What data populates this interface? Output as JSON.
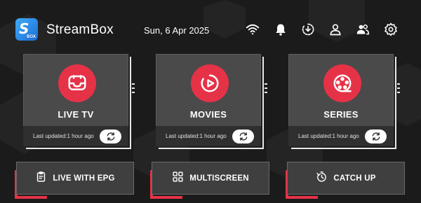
{
  "app": {
    "title": "StreamBox",
    "logo_letter": "S",
    "logo_sub": "BOX"
  },
  "header": {
    "date": "Sun, 6 Apr 2025",
    "icons": [
      "wifi-icon",
      "bell-icon",
      "download-icon",
      "user-icon",
      "users-icon",
      "settings-icon"
    ]
  },
  "cards": [
    {
      "label": "LIVE TV",
      "icon": "tv-icon",
      "updated": "Last updated:1 hour ago"
    },
    {
      "label": "MOVIES",
      "icon": "play-icon",
      "updated": "Last updated:1 hour ago"
    },
    {
      "label": "SERIES",
      "icon": "film-reel-icon",
      "updated": "Last updated:1 hour ago"
    }
  ],
  "buttons": [
    {
      "label": "LIVE WITH EPG",
      "icon": "clipboard-icon"
    },
    {
      "label": "MULTISCREEN",
      "icon": "grid-icon"
    },
    {
      "label": "CATCH UP",
      "icon": "timer-icon"
    }
  ],
  "colors": {
    "accent": "#e63247",
    "background": "#1b1b1b",
    "card": "#4a4a4a",
    "logo": "#1e6fd9"
  }
}
